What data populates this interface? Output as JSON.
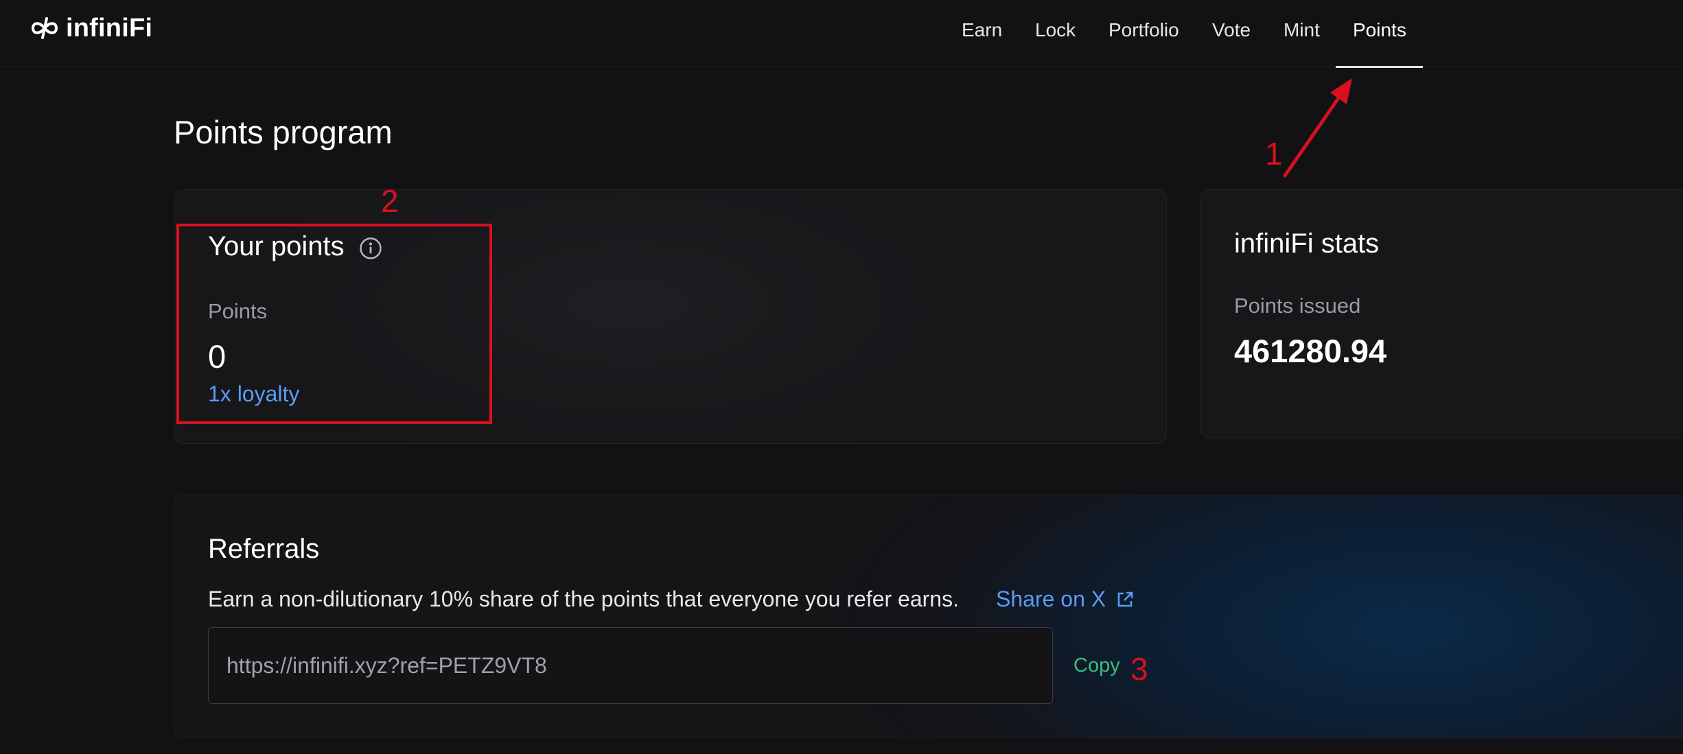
{
  "header": {
    "brand": "infiniFi",
    "nav": [
      {
        "label": "Earn"
      },
      {
        "label": "Lock"
      },
      {
        "label": "Portfolio"
      },
      {
        "label": "Vote"
      },
      {
        "label": "Mint"
      },
      {
        "label": "Points"
      }
    ],
    "active_nav": "Points"
  },
  "page": {
    "title": "Points program"
  },
  "your_points": {
    "title": "Your points",
    "points_label": "Points",
    "points_value": "0",
    "loyalty": "1x loyalty"
  },
  "stats": {
    "title": "infiniFi stats",
    "issued_label": "Points issued",
    "issued_value": "461280.94"
  },
  "referrals": {
    "title": "Referrals",
    "description": "Earn a non-dilutionary 10% share of the points that everyone you refer earns.",
    "share_label": "Share on X",
    "link_value": "https://infinifi.xyz?ref=PETZ9VT8",
    "copy_label": "Copy"
  },
  "annotations": {
    "one": "1",
    "two": "2",
    "three": "3"
  },
  "colors": {
    "background": "#121214",
    "accent_blue": "#5b9cf5",
    "copy_green": "#3bbf7a",
    "annotation_red": "#d9101e"
  },
  "icons": {
    "logo": "infinity-icon",
    "info": "info-icon",
    "external_link": "external-link-icon"
  }
}
